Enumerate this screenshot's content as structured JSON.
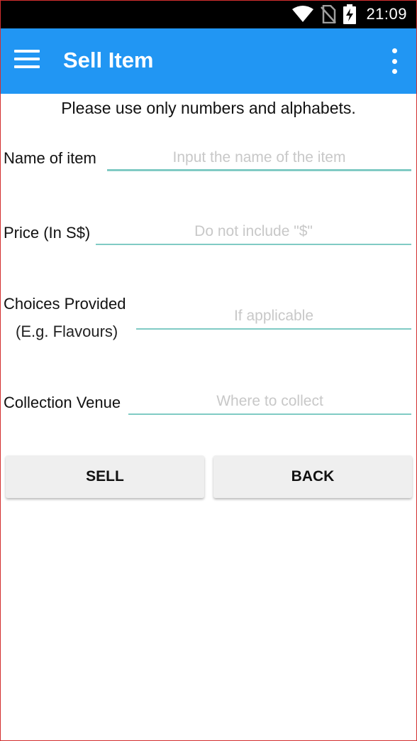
{
  "status_bar": {
    "time": "21:09",
    "icons": [
      "wifi-icon",
      "no-sim-icon",
      "battery-charging-icon"
    ]
  },
  "app_bar": {
    "title": "Sell Item",
    "color": "#2196f3",
    "menu_icon": "hamburger-menu-icon",
    "overflow_icon": "more-vertical-icon"
  },
  "form": {
    "instruction": "Please use only numbers and alphabets.",
    "name": {
      "label": "Name of item",
      "placeholder": "Input the name of the item",
      "value": ""
    },
    "price": {
      "label": "Price (In S$)",
      "placeholder": "Do not include \"$\"",
      "value": ""
    },
    "choices": {
      "label": "Choices Provided",
      "sublabel": "(E.g. Flavours)",
      "placeholder": "If applicable",
      "value": ""
    },
    "venue": {
      "label": "Collection Venue",
      "placeholder": "Where to collect",
      "value": ""
    },
    "underline_color": "#80cbc4"
  },
  "buttons": {
    "sell": "SELL",
    "back": "BACK"
  }
}
